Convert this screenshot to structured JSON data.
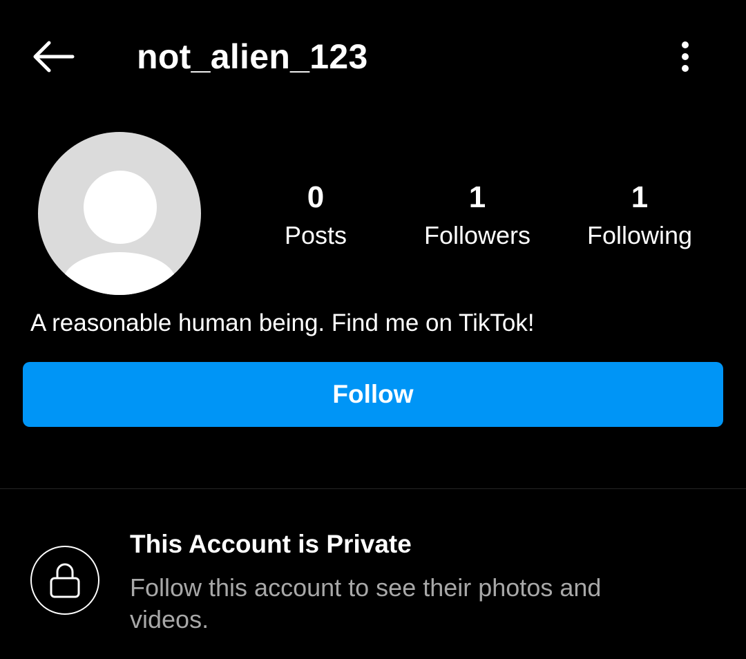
{
  "header": {
    "back_icon": "arrow-left-icon",
    "username": "not_alien_123",
    "more_icon": "vertical-dots-icon"
  },
  "profile": {
    "avatar_icon": "default-avatar-icon",
    "stats": {
      "posts": {
        "count": "0",
        "label": "Posts"
      },
      "followers": {
        "count": "1",
        "label": "Followers"
      },
      "following": {
        "count": "1",
        "label": "Following"
      }
    },
    "bio": "A reasonable human being. Find me on TikTok!"
  },
  "actions": {
    "follow_label": "Follow"
  },
  "private_notice": {
    "icon": "lock-icon",
    "title": "This Account is Private",
    "subtitle": "Follow this account to see their photos and videos."
  },
  "colors": {
    "background": "#000000",
    "accent": "#0095f6",
    "text": "#ffffff",
    "secondary_text": "#a8a8a8",
    "avatar_bg": "#dbdbdb"
  }
}
